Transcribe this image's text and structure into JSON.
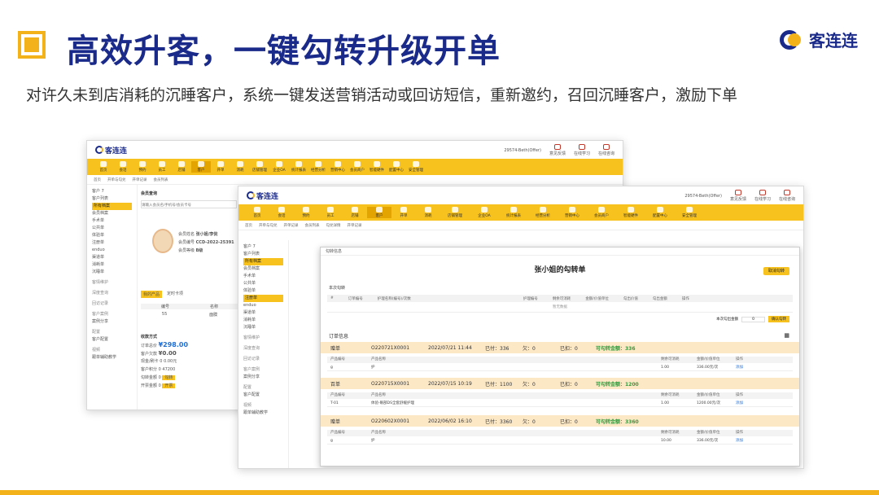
{
  "header": {
    "title": "高效升客，一键勾转升级开单",
    "subtitle": "对许久未到店消耗的沉睡客户，系统一键发送营销活动或回访短信，重新邀约，召回沉睡客户，激励下单",
    "brand": "客连连"
  },
  "app": {
    "logo_text": "客连连",
    "user": "29574-Beth(Offer)",
    "top_buttons": [
      "意见反馈",
      "在线学习",
      "在线咨询"
    ],
    "nav_items": [
      "首页",
      "会话",
      "预约",
      "员工",
      "店铺",
      "客户",
      "开单",
      "消耗",
      "店铺管理",
      "企业OA",
      "统计报表",
      "经营分析",
      "营销中心",
      "会员商户",
      "智能硬件",
      "配置中心",
      "安全管理"
    ],
    "tabs": [
      "首页",
      "开单与勾兑",
      "开单记录",
      "会员列表",
      "勾兑详情",
      "开单记录"
    ],
    "sidebar": {
      "title": "客户 7",
      "items": [
        "客户列表",
        "所有档案",
        "会员档案",
        "手术单",
        "公共单",
        "体验单",
        "注册单",
        "enduo",
        "渠道单",
        "消耗单",
        "沉睡单"
      ],
      "groups": [
        "客情维护",
        "深度查询",
        "回访记录",
        "客户案例",
        "案例分享",
        "配置",
        "客户配置",
        "视频",
        "跟单辅助教学"
      ]
    }
  },
  "member": {
    "section": "会员查询",
    "search_placeholder": "请输入会员名/手机号/会员卡号",
    "name_label": "会员姓名",
    "name": "张小姐/李倪",
    "no_label": "会员编号",
    "no": "CCD-2022-25391",
    "level_label": "会员等级",
    "level": "B级",
    "tabs": [
      "我的产品",
      "定时卡项"
    ],
    "table_head": [
      "编号",
      "名称"
    ],
    "table_row": [
      "55",
      "面膜"
    ],
    "pay_title": "收款方式",
    "pay_total_label": "订单总价",
    "pay_total": "¥298.00",
    "pay_owed_label": "客户欠款",
    "pay_owed": "¥0.00",
    "pay_rows": [
      "现金/刷卡",
      "客户积分",
      "勾转金额",
      "开票金额"
    ],
    "pay_values": [
      "0",
      "0",
      "0",
      "0"
    ],
    "pay_hints": [
      "0.00元",
      "47200",
      "",
      ""
    ],
    "pay_btns": [
      "勾转",
      "开票"
    ]
  },
  "modal": {
    "header": "勾转信息",
    "title": "张小姐的勾转单",
    "cancel": "取消勾转",
    "section1": "本次勾转",
    "grid_cols": [
      "#",
      "订单编号",
      "护理名称(编号)/次数",
      "护理编号",
      "剩余可消耗",
      "金额/价值单位",
      "勾出价值",
      "勾出金额",
      "操作"
    ],
    "empty": "暂无数据",
    "total_label": "本次勾出金额",
    "total_value": "0",
    "confirm": "确认勾转",
    "section2": "订单信息",
    "orders": [
      {
        "type": "赠单",
        "no": "O220721X0001",
        "date": "2022/07/21 11:44",
        "paid": "已付：336",
        "owe": "欠：0",
        "used": "已扣：0",
        "avail": "可勾转金额：336",
        "sub_cols": [
          "产品编号",
          "产品名称",
          "剩余可消耗",
          "金额/价值单位",
          "操作"
        ],
        "row": [
          "g",
          "护",
          "1.00",
          "336.00元/次",
          "添加"
        ]
      },
      {
        "type": "百单",
        "no": "O220715X0001",
        "date": "2022/07/15 10:19",
        "paid": "已付：1100",
        "owe": "欠：0",
        "used": "已扣：0",
        "avail": "可勾转金额：1200",
        "sub_cols": [
          "产品编号",
          "产品名称",
          "剩余可消耗",
          "金额/价值单位",
          "操作"
        ],
        "row": [
          "T-01",
          "体验-眼部DS全套舒缓护理",
          "1.00",
          "1200.00元/次",
          "添加"
        ]
      },
      {
        "type": "赠单",
        "no": "O220602X0001",
        "date": "2022/06/02 16:10",
        "paid": "已付：3360",
        "owe": "欠：0",
        "used": "已扣：0",
        "avail": "可勾转金额：3360",
        "sub_cols": [
          "产品编号",
          "产品名称",
          "剩余可消耗",
          "金额/价值单位",
          "操作"
        ],
        "row": [
          "g",
          "护",
          "10.00",
          "336.00元/次",
          "添加"
        ]
      }
    ]
  }
}
